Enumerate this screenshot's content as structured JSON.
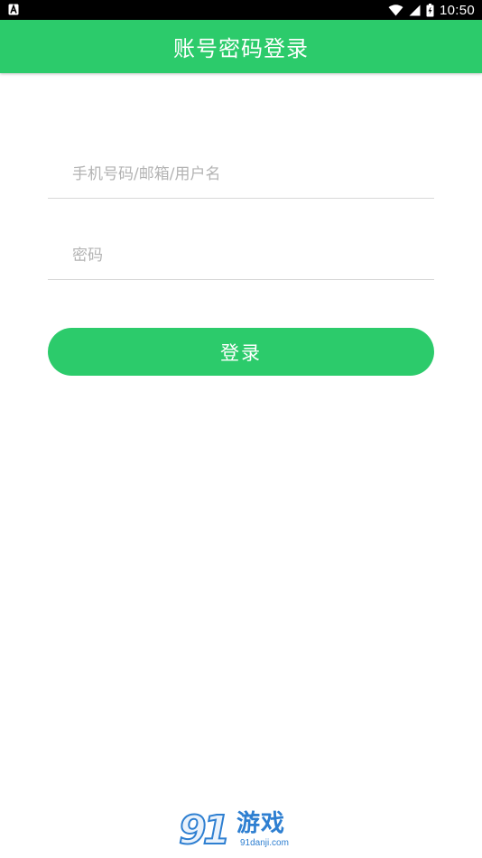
{
  "status_bar": {
    "time": "10:50",
    "icons": [
      "notification-a-icon",
      "wifi-icon",
      "signal-icon",
      "battery-icon"
    ]
  },
  "app_bar": {
    "title": "账号密码登录"
  },
  "form": {
    "account": {
      "value": "",
      "placeholder": "手机号码/邮箱/用户名"
    },
    "password": {
      "value": "",
      "placeholder": "密码"
    },
    "submit_label": "登录"
  },
  "watermark": {
    "logo_number": "91",
    "logo_text": "游戏",
    "logo_domain": "91danji.com"
  },
  "colors": {
    "accent": "#2ccb6b",
    "status_bar": "#000000",
    "placeholder": "#b3b3b3",
    "divider": "#d8d8d8",
    "watermark": "#2e7fd1"
  }
}
